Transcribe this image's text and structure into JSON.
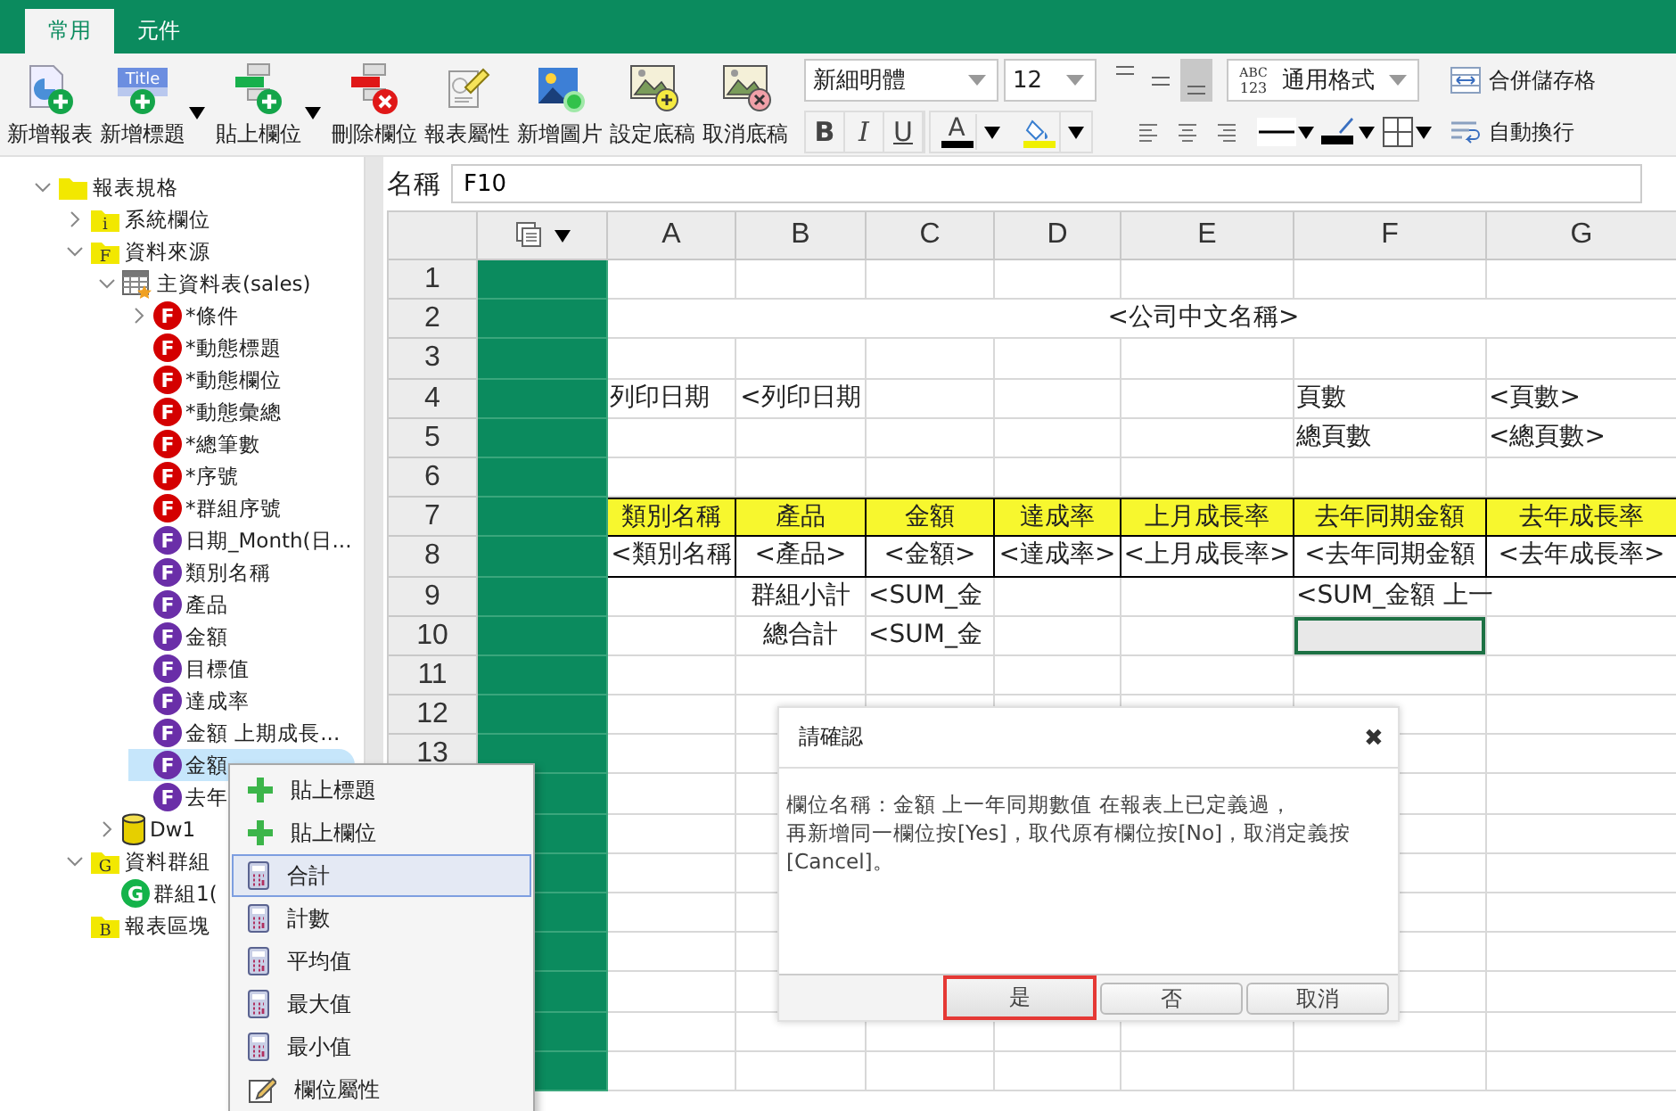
{
  "tabs": [
    {
      "label": "常用",
      "selected": true
    },
    {
      "label": "元件",
      "selected": false
    }
  ],
  "toolbar": {
    "buttons": [
      {
        "kind": "report-add",
        "label": "新增報表",
        "dropdown": false
      },
      {
        "kind": "title-add",
        "label": "新增標題",
        "dropdown": true,
        "icon_text": "Title"
      },
      {
        "kind": "field-paste",
        "label": "貼上欄位",
        "dropdown": true
      },
      {
        "kind": "field-delete",
        "label": "刪除欄位",
        "dropdown": false
      },
      {
        "kind": "properties",
        "label": "報表屬性",
        "dropdown": false
      },
      {
        "kind": "image-add",
        "label": "新增圖片",
        "dropdown": false
      },
      {
        "kind": "template-set",
        "label": "設定底稿",
        "dropdown": false
      },
      {
        "kind": "template-cancel",
        "label": "取消底稿",
        "dropdown": false
      }
    ]
  },
  "format_bar": {
    "font": "新細明體",
    "size": "12",
    "vertical_align": [
      {
        "kind": "top",
        "selected": false
      },
      {
        "kind": "middle",
        "selected": false
      },
      {
        "kind": "bottom",
        "selected": true
      }
    ],
    "number_format": {
      "value": "通用格式",
      "icon_text": [
        "ABC",
        "123"
      ]
    },
    "merge_button": "合併儲存格",
    "styles": [
      {
        "kind": "bold",
        "label": "B"
      },
      {
        "kind": "italic",
        "label": "I"
      },
      {
        "kind": "underline",
        "label": "U"
      }
    ],
    "font_color_label": "A",
    "align": [
      {
        "kind": "left"
      },
      {
        "kind": "center"
      },
      {
        "kind": "right"
      }
    ],
    "wrap_button": "自動換行"
  },
  "tree": [
    {
      "label": "報表規格",
      "kind": "folder",
      "expanded": true,
      "selected": false,
      "children": [
        {
          "label": "系統欄位",
          "kind": "folder",
          "badge": "i",
          "expanded": false,
          "selected": false
        },
        {
          "label": "資料來源",
          "kind": "folder",
          "badge": "F",
          "expanded": true,
          "selected": false,
          "children": [
            {
              "label": "主資料表(sales)",
              "kind": "table",
              "expanded": true,
              "selected": false,
              "children": [
                {
                  "label": "*條件",
                  "kind": "field-red",
                  "badge": "F",
                  "expanded": false,
                  "selected": false
                },
                {
                  "label": "*動態標題",
                  "kind": "field-red",
                  "badge": "F",
                  "selected": false
                },
                {
                  "label": "*動態欄位",
                  "kind": "field-red",
                  "badge": "F",
                  "selected": false
                },
                {
                  "label": "*動態彙總",
                  "kind": "field-red",
                  "badge": "F",
                  "selected": false
                },
                {
                  "label": "*總筆數",
                  "kind": "field-red",
                  "badge": "F",
                  "selected": false
                },
                {
                  "label": "*序號",
                  "kind": "field-red",
                  "badge": "F",
                  "selected": false
                },
                {
                  "label": "*群組序號",
                  "kind": "field-red",
                  "badge": "F",
                  "selected": false
                },
                {
                  "label": "日期_Month(日...",
                  "kind": "field-purple",
                  "badge": "F",
                  "selected": false
                },
                {
                  "label": "類別名稱",
                  "kind": "field-purple",
                  "badge": "F",
                  "selected": false
                },
                {
                  "label": "產品",
                  "kind": "field-purple",
                  "badge": "F",
                  "selected": false
                },
                {
                  "label": "金額",
                  "kind": "field-purple",
                  "badge": "F",
                  "selected": false
                },
                {
                  "label": "目標值",
                  "kind": "field-purple",
                  "badge": "F",
                  "selected": false
                },
                {
                  "label": "達成率",
                  "kind": "field-purple",
                  "badge": "F",
                  "selected": false
                },
                {
                  "label": "金額 上期成長...",
                  "kind": "field-purple",
                  "badge": "F",
                  "selected": false
                },
                {
                  "label": "金額",
                  "kind": "field-purple",
                  "badge": "F",
                  "selected": true
                },
                {
                  "label": "去年",
                  "kind": "field-purple",
                  "badge": "F",
                  "selected": false
                }
              ]
            },
            {
              "label": "Dw1",
              "kind": "database",
              "expanded": false,
              "selected": false
            }
          ]
        },
        {
          "label": "資料群組",
          "kind": "folder",
          "badge": "G",
          "expanded": true,
          "selected": false,
          "children": [
            {
              "label": "群組1(",
              "kind": "group",
              "badge": "G",
              "selected": false
            }
          ]
        },
        {
          "label": "報表區塊",
          "kind": "folder",
          "badge": "B",
          "selected": false
        }
      ]
    }
  ],
  "name_box": {
    "label": "名稱",
    "value": "F10"
  },
  "sheet": {
    "columns": [
      "A",
      "B",
      "C",
      "D",
      "E",
      "F",
      "G"
    ],
    "rows": [
      {
        "number": "1",
        "kind": "plain"
      },
      {
        "number": "2",
        "kind": "title",
        "title": "<公司中文名稱>"
      },
      {
        "number": "3",
        "kind": "plain"
      },
      {
        "number": "4",
        "kind": "plain",
        "a": "列印日期",
        "b": "<列印日期",
        "f": "頁數",
        "g": "<頁數>"
      },
      {
        "number": "5",
        "kind": "plain",
        "f": "總頁數",
        "g": "<總頁數>"
      },
      {
        "number": "6",
        "kind": "plain"
      },
      {
        "number": "7",
        "kind": "header",
        "a": "類別名稱",
        "b": "產品",
        "c": "金額",
        "d": "達成率",
        "e": "上月成長率",
        "f": "去年同期金額",
        "g": "去年成長率"
      },
      {
        "number": "8",
        "kind": "field",
        "a": "<類別名稱",
        "b": "<產品>",
        "c": "<金額>",
        "d": "<達成率>",
        "e": "<上月成長率>",
        "f": "<去年同期金額",
        "g": "<去年成長率>"
      },
      {
        "number": "9",
        "kind": "plain",
        "b": "群組小計",
        "c": "<SUM_金",
        "f": "<SUM_金額 上一"
      },
      {
        "number": "10",
        "kind": "plain",
        "b": "總合計",
        "c": "<SUM_金",
        "f": {
          "selected": true
        }
      },
      {
        "number": "11",
        "kind": "plain"
      },
      {
        "number": "12",
        "kind": "plain"
      },
      {
        "number": "13",
        "kind": "plain"
      }
    ]
  },
  "context_menu": {
    "items": [
      {
        "kind": "add",
        "label": "貼上標題",
        "selected": false
      },
      {
        "kind": "add",
        "label": "貼上欄位",
        "selected": false
      },
      {
        "kind": "calc",
        "label": "合計",
        "selected": true
      },
      {
        "kind": "calc",
        "label": "計數",
        "selected": false
      },
      {
        "kind": "calc",
        "label": "平均值",
        "selected": false
      },
      {
        "kind": "calc",
        "label": "最大值",
        "selected": false
      },
      {
        "kind": "calc",
        "label": "最小值",
        "selected": false
      },
      {
        "kind": "edit",
        "label": "欄位屬性",
        "selected": false
      }
    ]
  },
  "dialog": {
    "title": "請確認",
    "close": "✖",
    "message": [
      "欄位名稱：金額 上一年同期數值 在報表上已定義過，",
      "再新增同一欄位按[Yes]，取代原有欄位按[No]，取消定義按",
      "[Cancel]。"
    ],
    "buttons": [
      {
        "label": "是",
        "highlighted": true
      },
      {
        "label": "否",
        "highlighted": false
      },
      {
        "label": "取消",
        "highlighted": false
      }
    ]
  }
}
